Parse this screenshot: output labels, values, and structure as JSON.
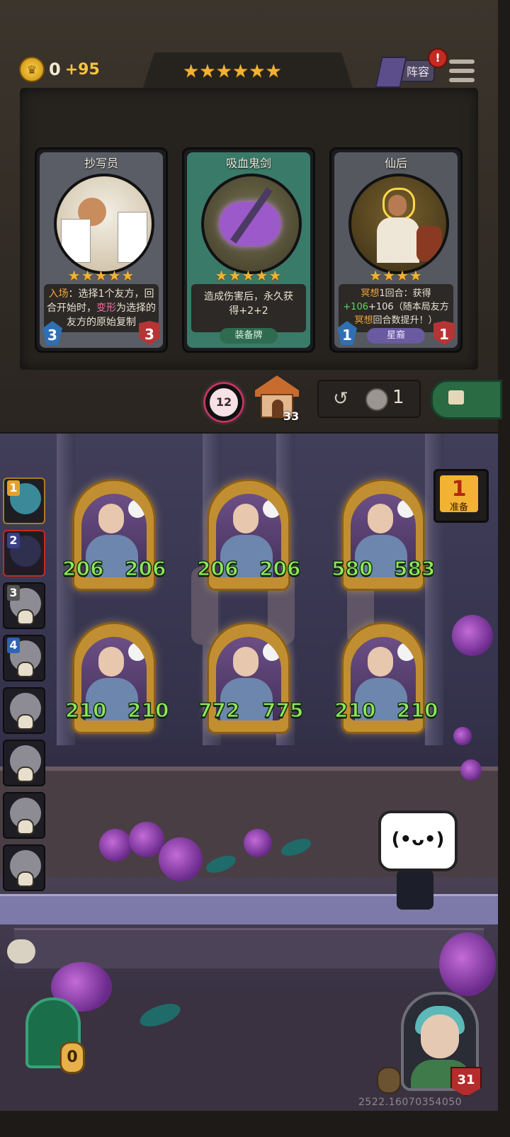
{
  "top_bar": {
    "gold_value": "0",
    "gold_bonus": "+95",
    "tier_stars": "★★★★★★",
    "lineup_label": "阵容",
    "lineup_alert": "!",
    "menu_icon": "hamburger-menu-icon"
  },
  "shop_cards": [
    {
      "title": "抄写员",
      "stars": "★★★★★",
      "desc_parts": [
        "入场",
        "：选择1个友方，回合开始时，",
        "变形",
        "为选择的友方的原始复制"
      ],
      "attack": "3",
      "health": "3",
      "tag": "",
      "frame_color": "#5a5d66"
    },
    {
      "title": "吸血鬼剑",
      "stars": "★★★★★",
      "desc": "造成伤害后，永久获得+2+2",
      "tag": "装备牌",
      "frame_color": "#3a7a68"
    },
    {
      "title": "仙后",
      "stars": "★★★★",
      "desc_parts": [
        "冥想",
        "1回合：获得",
        "+106",
        "+106（随本局友方",
        "冥想",
        "回合数提升！）"
      ],
      "attack": "1",
      "health": "1",
      "tag": "星裔",
      "frame_color": "#55585f"
    }
  ],
  "shop_toolbar": {
    "orb_value": "12",
    "house_count": "33",
    "refresh_cost": "1",
    "lock_icon": "lock-icon"
  },
  "ready": {
    "number": "1",
    "label": "准备"
  },
  "queue": [
    {
      "num": "1",
      "active": true,
      "num_color": "#e4a12a"
    },
    {
      "num": "2",
      "active": true,
      "num_color": "#3a3f86"
    },
    {
      "num": "3",
      "active": false,
      "num_color": "#444"
    },
    {
      "num": "4",
      "active": false,
      "num_color": "#2f63b5"
    },
    {
      "num": "",
      "active": false
    },
    {
      "num": "",
      "active": false
    },
    {
      "num": "",
      "active": false
    },
    {
      "num": "",
      "active": false
    }
  ],
  "minions": [
    {
      "attack": "206",
      "health": "206"
    },
    {
      "attack": "206",
      "health": "206"
    },
    {
      "attack": "580",
      "health": "583"
    },
    {
      "attack": "210",
      "health": "210"
    },
    {
      "attack": "772",
      "health": "775"
    },
    {
      "attack": "210",
      "health": "210"
    }
  ],
  "bottom": {
    "plant_count": "0",
    "hero_health": "31",
    "build_number": "2522.16070354050",
    "bili_face": "(•ᴗ•)"
  }
}
